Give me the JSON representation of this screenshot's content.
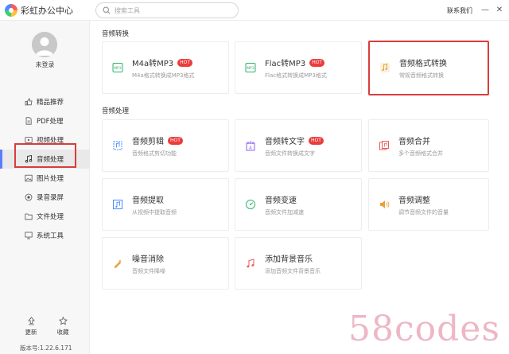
{
  "app": {
    "title": "彩虹办公中心",
    "contact": "联系我们"
  },
  "search": {
    "placeholder": "搜索工具"
  },
  "window_controls": {
    "minimize": "—",
    "close": "✕"
  },
  "user": {
    "status": "未登录"
  },
  "sidebar": {
    "items": [
      {
        "label": "精品推荐",
        "icon": "thumbs-up-icon"
      },
      {
        "label": "PDF处理",
        "icon": "document-icon"
      },
      {
        "label": "视频处理",
        "icon": "video-icon"
      },
      {
        "label": "音频处理",
        "icon": "music-note-icon",
        "active": true
      },
      {
        "label": "图片处理",
        "icon": "image-icon"
      },
      {
        "label": "录音录屏",
        "icon": "record-icon"
      },
      {
        "label": "文件处理",
        "icon": "folder-icon"
      },
      {
        "label": "系统工具",
        "icon": "monitor-icon"
      }
    ],
    "bottom": [
      {
        "label": "更新",
        "icon": "update-icon"
      },
      {
        "label": "收藏",
        "icon": "star-icon"
      }
    ],
    "version": "版本号:1.22.6.171"
  },
  "sections": [
    {
      "title": "音频转换",
      "cards": [
        {
          "title": "M4a转MP3",
          "desc": "M4a格式转换成MP3格式",
          "hot": "HOT",
          "icon": "m4a-convert-icon",
          "color": "#2fb36b"
        },
        {
          "title": "Flac转MP3",
          "desc": "Flac格式转换成MP3格式",
          "hot": "HOT",
          "icon": "flac-convert-icon",
          "color": "#2fb36b"
        },
        {
          "title": "音频格式转换",
          "desc": "常规音频格式转换",
          "hot": "",
          "icon": "audio-format-icon",
          "color": "#e8a23a",
          "selected": true
        }
      ]
    },
    {
      "title": "音频处理",
      "cards": [
        {
          "title": "音频剪辑",
          "desc": "音频格式剪切功能",
          "hot": "HOT",
          "icon": "audio-cut-icon",
          "color": "#4a8cff"
        },
        {
          "title": "音频转文字",
          "desc": "音频文件转换成文字",
          "hot": "HOT",
          "icon": "audio-to-text-icon",
          "color": "#8a5cf5"
        },
        {
          "title": "音频合并",
          "desc": "多个音频格式合并",
          "hot": "",
          "icon": "audio-merge-icon",
          "color": "#e85a5a"
        },
        {
          "title": "音频提取",
          "desc": "从视频中提取音频",
          "hot": "",
          "icon": "audio-extract-icon",
          "color": "#4a8cff"
        },
        {
          "title": "音频变速",
          "desc": "音频文件加减速",
          "hot": "",
          "icon": "audio-speed-icon",
          "color": "#2fb36b"
        },
        {
          "title": "音频调整",
          "desc": "调节音频文件的音量",
          "hot": "",
          "icon": "audio-volume-icon",
          "color": "#e8a23a"
        },
        {
          "title": "噪音消除",
          "desc": "音频文件降噪",
          "hot": "",
          "icon": "noise-remove-icon",
          "color": "#e8a23a"
        },
        {
          "title": "添加背景音乐",
          "desc": "添加音频文件背景音乐",
          "hot": "",
          "icon": "bgm-add-icon",
          "color": "#e85a5a"
        }
      ]
    }
  ],
  "watermark": "58codes"
}
